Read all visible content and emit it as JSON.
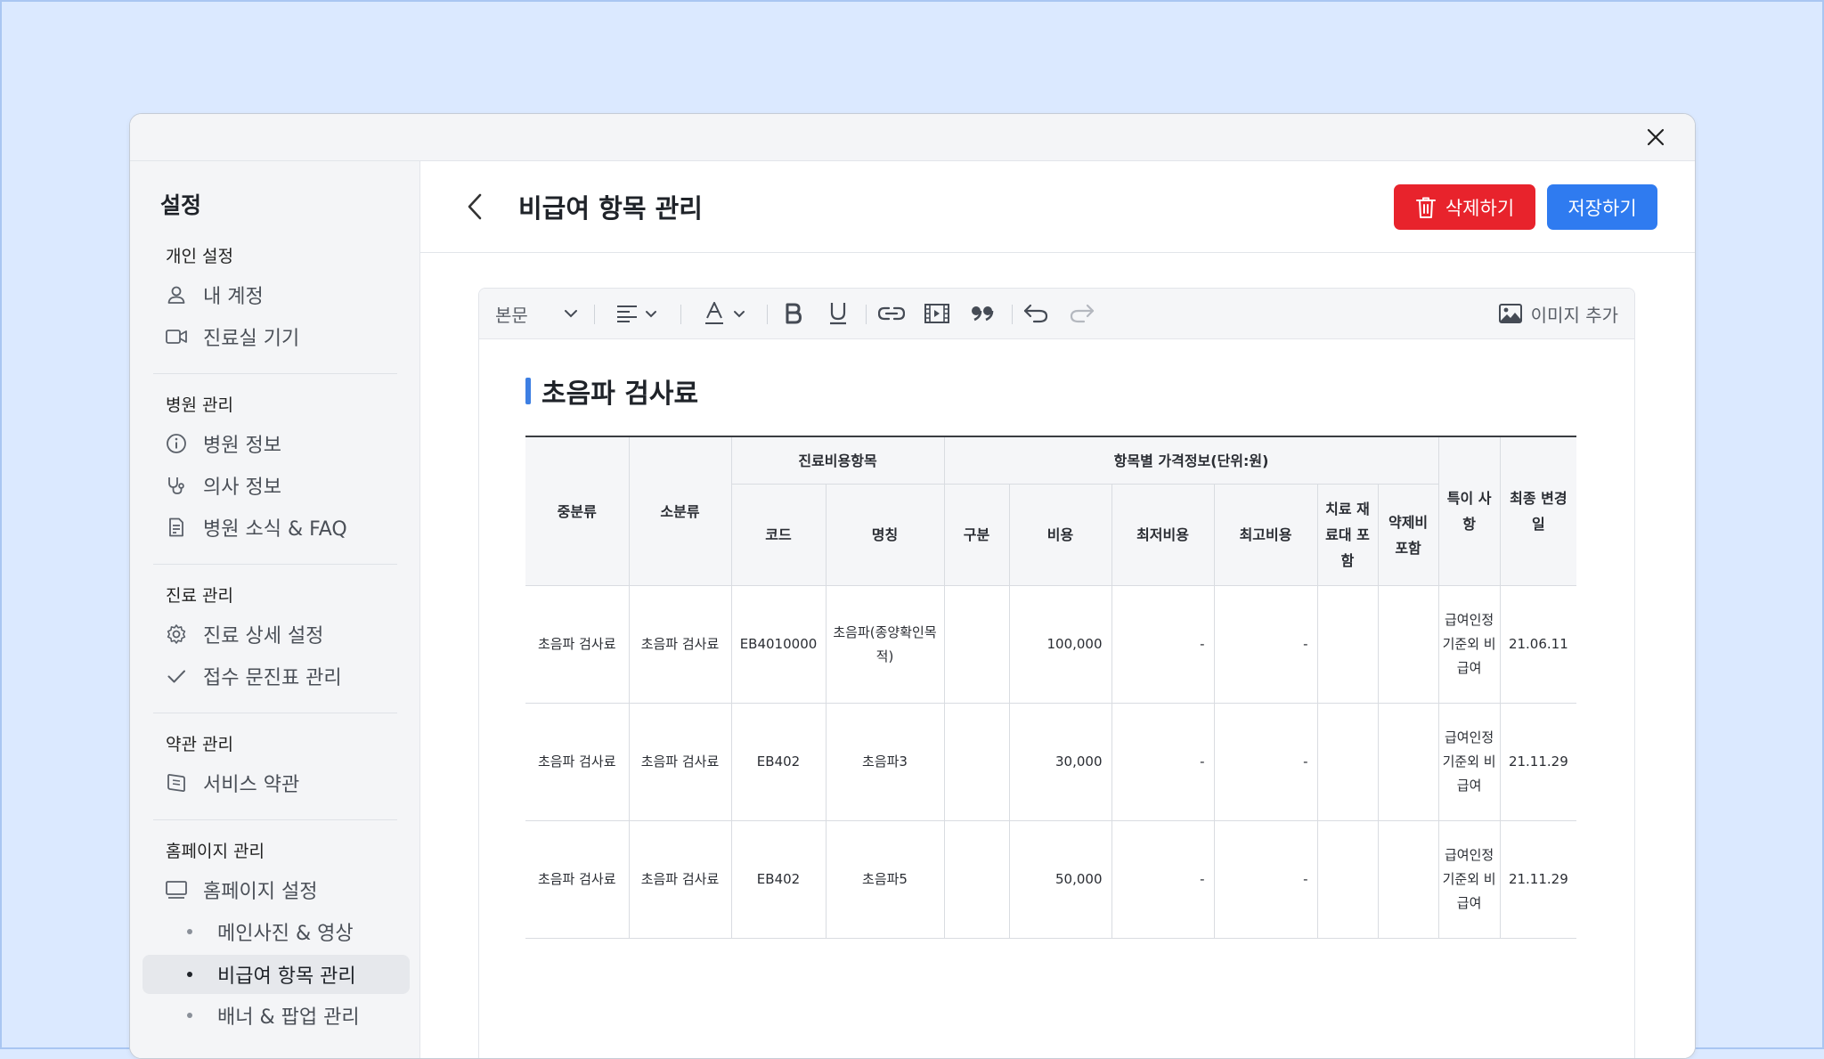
{
  "sidebar": {
    "title": "설정",
    "sections": [
      {
        "label": "개인 설정",
        "items": [
          {
            "label": "내 계정",
            "icon": "user-icon"
          },
          {
            "label": "진료실 기기",
            "icon": "video-camera-icon"
          }
        ]
      },
      {
        "label": "병원 관리",
        "items": [
          {
            "label": "병원 정보",
            "icon": "info-icon"
          },
          {
            "label": "의사 정보",
            "icon": "stethoscope-icon"
          },
          {
            "label": "병원 소식 & FAQ",
            "icon": "document-icon"
          }
        ]
      },
      {
        "label": "진료 관리",
        "items": [
          {
            "label": "진료 상세 설정",
            "icon": "gear-icon"
          },
          {
            "label": "접수 문진표 관리",
            "icon": "check-icon"
          }
        ]
      },
      {
        "label": "약관 관리",
        "items": [
          {
            "label": "서비스 약관",
            "icon": "book-icon"
          }
        ]
      },
      {
        "label": "홈페이지 관리",
        "items": [
          {
            "label": "홈페이지 설정",
            "icon": "monitor-icon"
          }
        ],
        "subitems": [
          {
            "label": "메인사진 & 영상",
            "active": false
          },
          {
            "label": "비급여 항목 관리",
            "active": true
          },
          {
            "label": "배너 & 팝업 관리",
            "active": false
          }
        ]
      }
    ]
  },
  "header": {
    "title": "비급여 항목 관리",
    "delete_label": "삭제하기",
    "save_label": "저장하기"
  },
  "toolbar": {
    "style_label": "본문",
    "image_label": "이미지 추가"
  },
  "document": {
    "heading": "초음파 검사료",
    "table": {
      "headers": {
        "mid": "중분류",
        "sub": "소분류",
        "group_item": "진료비용항목",
        "group_price": "항목별 가격정보(단위:원)",
        "special": "특이 사항",
        "updated": "최종 변경일",
        "code": "코드",
        "name": "명칭",
        "type": "구분",
        "cost": "비용",
        "min": "최저비용",
        "max": "최고비용",
        "material": "치료 재료대 포함",
        "drug": "약제비 포함"
      },
      "rows": [
        {
          "mid": "초음파 검사료",
          "sub": "초음파 검사료",
          "code": "EB4010000",
          "name": "초음파(종양확인목적)",
          "type": "",
          "cost": "100,000",
          "min": "-",
          "max": "-",
          "material": "",
          "drug": "",
          "special": "급여인정 기준외 비급여",
          "updated": "21.06.11"
        },
        {
          "mid": "초음파 검사료",
          "sub": "초음파 검사료",
          "code": "EB402",
          "name": "초음파3",
          "type": "",
          "cost": "30,000",
          "min": "-",
          "max": "-",
          "material": "",
          "drug": "",
          "special": "급여인정 기준외 비급여",
          "updated": "21.11.29"
        },
        {
          "mid": "초음파 검사료",
          "sub": "초음파 검사료",
          "code": "EB402",
          "name": "초음파5",
          "type": "",
          "cost": "50,000",
          "min": "-",
          "max": "-",
          "material": "",
          "drug": "",
          "special": "급여인정 기준외 비급여",
          "updated": "21.11.29"
        }
      ]
    }
  },
  "colors": {
    "delete": "#e8232c",
    "save": "#2f7bf0",
    "heading_bar": "#3d7fe3",
    "background": "#dbe9ff"
  }
}
